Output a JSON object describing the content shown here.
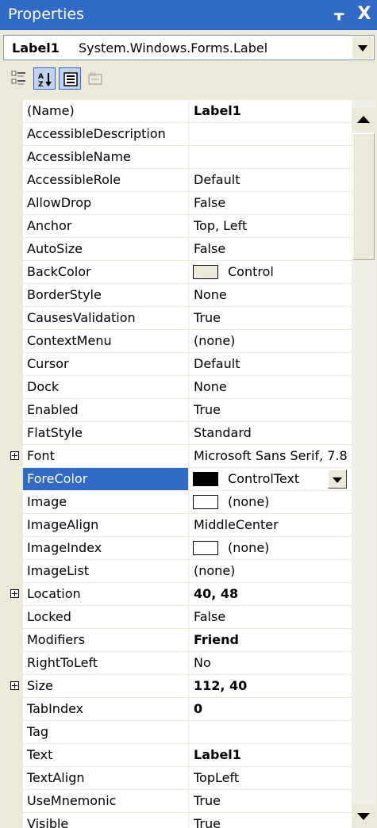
{
  "window": {
    "title": "Properties",
    "pin_glyph": "ᚁ",
    "close_glyph": "X",
    "title_color": "#316ac5"
  },
  "object_selector": {
    "name": "Label1",
    "type": "System.Windows.Forms.Label"
  },
  "toolbar": {
    "buttons": [
      {
        "icon": "categorized-icon",
        "active": false
      },
      {
        "icon": "alphabetical-icon",
        "active": true
      },
      {
        "icon": "properties-icon",
        "active": true
      },
      {
        "icon": "property-pages-icon",
        "active": false
      }
    ]
  },
  "properties": [
    {
      "name": "(Name)",
      "value": "Label1",
      "bold": true
    },
    {
      "name": "AccessibleDescription",
      "value": ""
    },
    {
      "name": "AccessibleName",
      "value": ""
    },
    {
      "name": "AccessibleRole",
      "value": "Default"
    },
    {
      "name": "AllowDrop",
      "value": "False"
    },
    {
      "name": "Anchor",
      "value": "Top, Left"
    },
    {
      "name": "AutoSize",
      "value": "False"
    },
    {
      "name": "BackColor",
      "value": "Control",
      "swatch": "#ece9d8"
    },
    {
      "name": "BorderStyle",
      "value": "None"
    },
    {
      "name": "CausesValidation",
      "value": "True"
    },
    {
      "name": "ContextMenu",
      "value": "(none)"
    },
    {
      "name": "Cursor",
      "value": "Default"
    },
    {
      "name": "Dock",
      "value": "None"
    },
    {
      "name": "Enabled",
      "value": "True"
    },
    {
      "name": "FlatStyle",
      "value": "Standard"
    },
    {
      "name": "Font",
      "value": "Microsoft Sans Serif, 7.8",
      "expandable": true
    },
    {
      "name": "ForeColor",
      "value": "ControlText",
      "swatch": "#000000",
      "selected": true,
      "dropdown": true
    },
    {
      "name": "Image",
      "value": "(none)",
      "swatch": "#ffffff"
    },
    {
      "name": "ImageAlign",
      "value": "MiddleCenter"
    },
    {
      "name": "ImageIndex",
      "value": "(none)",
      "swatch": "#ffffff"
    },
    {
      "name": "ImageList",
      "value": "(none)"
    },
    {
      "name": "Location",
      "value": "40, 48",
      "bold": true,
      "expandable": true
    },
    {
      "name": "Locked",
      "value": "False"
    },
    {
      "name": "Modifiers",
      "value": "Friend",
      "bold": true
    },
    {
      "name": "RightToLeft",
      "value": "No"
    },
    {
      "name": "Size",
      "value": "112, 40",
      "bold": true,
      "expandable": true
    },
    {
      "name": "TabIndex",
      "value": "0",
      "bold": true
    },
    {
      "name": "Tag",
      "value": ""
    },
    {
      "name": "Text",
      "value": "Label1",
      "bold": true
    },
    {
      "name": "TextAlign",
      "value": "TopLeft"
    },
    {
      "name": "UseMnemonic",
      "value": "True"
    },
    {
      "name": "Visible",
      "value": "True"
    }
  ],
  "colors": {
    "selection": "#316ac5",
    "chrome": "#ece9d8"
  }
}
